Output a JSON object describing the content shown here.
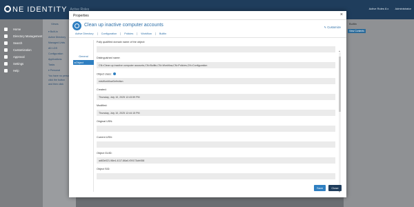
{
  "app": {
    "brand": "NE IDENTITY",
    "brand_sub": "Active Roles",
    "top_links": [
      "Active Roles 8.x",
      "Administrator"
    ]
  },
  "nav": {
    "items": [
      {
        "label": "Home",
        "icon": "home-icon"
      },
      {
        "label": "Directory Management",
        "icon": "folder-icon"
      },
      {
        "label": "Search",
        "icon": "search-icon"
      },
      {
        "label": "Customization",
        "icon": "customization-icon"
      },
      {
        "label": "Approval",
        "icon": "check-icon"
      },
      {
        "label": "Settings",
        "icon": "gear-icon"
      },
      {
        "label": "Help",
        "icon": "help-icon"
      }
    ]
  },
  "views": {
    "header": "Views",
    "lines": [
      "▾ Built-in",
      "Active Directory",
      "Managed Units",
      "AD LDS",
      "Configuration",
      "Applications",
      "Tasks",
      "▾ Personal",
      "You have no personal",
      "click the button",
      "and then click"
    ]
  },
  "rightpane": {
    "title": "Builtin",
    "button": "View Contents"
  },
  "dialog": {
    "title": "Properties",
    "close": "×",
    "object_title": "Clean up inactive computer accounts",
    "customize": "Customize",
    "toolbar": [
      "Active Directory",
      "Configuration",
      "Policies",
      "Workflow",
      "Builtin"
    ],
    "leftnav": [
      "General",
      "Object"
    ],
    "fields": [
      {
        "label": "Fully qualified domain name of the object:",
        "value": ""
      },
      {
        "label": "Distinguished name:",
        "value": "CN=Clean up inactive computer accounts,CN=Builtin,CN=Workflow,CN=Policies,CN=Configuration"
      },
      {
        "label": "Object class:",
        "value": "edsWorkflowDefinition"
      },
      {
        "label": "Created:",
        "value": "Thursday, July 10, 2025 12:43:59 PM"
      },
      {
        "label": "Modified:",
        "value": "Thursday, July 10, 2025 12:44:15 PM"
      },
      {
        "label": "Original USN:",
        "value": ""
      },
      {
        "label": "Current USN:",
        "value": ""
      },
      {
        "label": "Object GUID:",
        "value": "ad63e021-98e4-4117-86a0-f09173cbf458"
      },
      {
        "label": "Object SID:",
        "value": ""
      }
    ],
    "save": "Save",
    "close_button": "Close"
  }
}
